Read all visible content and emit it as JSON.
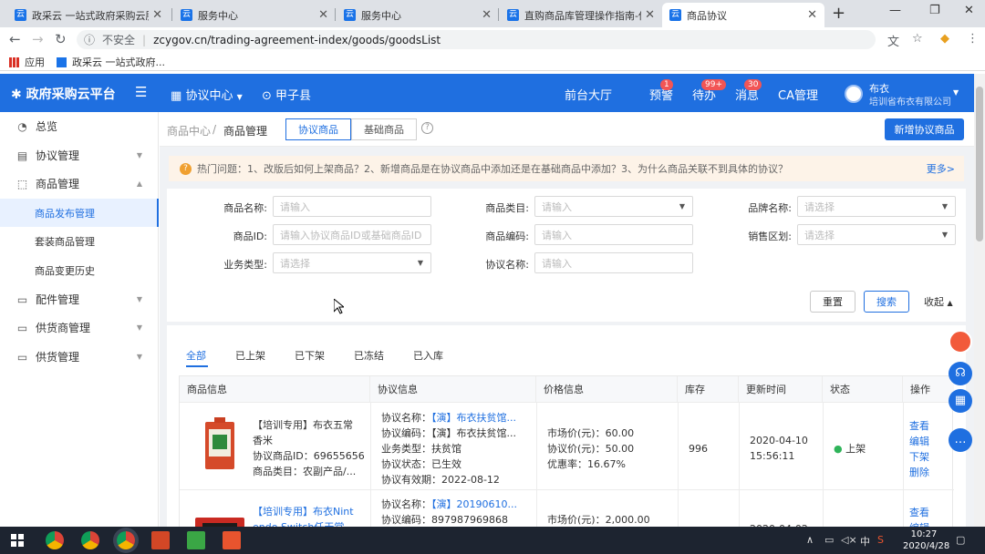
{
  "browser": {
    "tabs": [
      {
        "title": "政采云 一站式政府采购云服务"
      },
      {
        "title": "服务中心"
      },
      {
        "title": "服务中心"
      },
      {
        "title": "直购商品库管理操作指南-供应"
      },
      {
        "title": "商品协议"
      }
    ],
    "insecure_label": "不安全",
    "url": "zcygov.cn/trading-agreement-index/goods/goodsList",
    "bookmarks": [
      {
        "label": "应用"
      },
      {
        "label": "政采云 一站式政府..."
      }
    ]
  },
  "topnav": {
    "brand": "政府采购云平台",
    "agreement_center": "协议中心",
    "region": "甲子县",
    "hall": "前台大厅",
    "warning": "预警",
    "warning_count": "1",
    "todo": "待办",
    "todo_count": "99+",
    "messages": "消息",
    "messages_count": "30",
    "ca": "CA管理",
    "user_name": "布衣",
    "user_org": "培训省布衣有限公司"
  },
  "sidebar": {
    "items": [
      {
        "label": "总览"
      },
      {
        "label": "协议管理"
      },
      {
        "label": "商品管理"
      },
      {
        "label": "商品发布管理"
      },
      {
        "label": "套装商品管理"
      },
      {
        "label": "商品变更历史"
      },
      {
        "label": "配件管理"
      },
      {
        "label": "供货商管理"
      },
      {
        "label": "供货管理"
      }
    ]
  },
  "breadcrumb": {
    "root": "商品中心",
    "sep": "/",
    "current": "商品管理"
  },
  "segments": {
    "agreement_goods": "协议商品",
    "base_goods": "基础商品"
  },
  "new_button": "新增协议商品",
  "notice": {
    "text": "热门问题：1、改版后如何上架商品？2、新增商品是在协议商品中添加还是在基础商品中添加？3、为什么商品关联不到具体的协议？",
    "more": "更多>"
  },
  "filters": {
    "name_label": "商品名称:",
    "name_placeholder": "请输入",
    "category_label": "商品类目:",
    "category_placeholder": "请输入",
    "brand_label": "品牌名称:",
    "brand_placeholder": "请选择",
    "id_label": "商品ID:",
    "id_placeholder": "请输入协议商品ID或基础商品ID",
    "code_label": "商品编码:",
    "code_placeholder": "请输入",
    "region_label": "销售区划:",
    "region_placeholder": "请选择",
    "biz_label": "业务类型:",
    "biz_placeholder": "请选择",
    "agreement_label": "协议名称:",
    "agreement_placeholder": "请输入",
    "reset": "重置",
    "search": "搜索",
    "collapse": "收起"
  },
  "status_tabs": [
    "全部",
    "已上架",
    "已下架",
    "已冻结",
    "已入库"
  ],
  "table": {
    "columns": [
      "商品信息",
      "协议信息",
      "价格信息",
      "库存",
      "更新时间",
      "状态",
      "操作"
    ],
    "rows": [
      {
        "product_name_1": "【培训专用】布衣五常",
        "product_name_2": "香米",
        "product_id": "协议商品ID：69655656",
        "product_cat": "商品类目：农副产品/...",
        "agr_name_label": "协议名称：",
        "agr_name": "【演】布衣扶贫馆...",
        "agr_code": "协议编码：【演】布衣扶贫馆...",
        "biz_type": "业务类型：扶贫馆",
        "agr_status": "协议状态：已生效",
        "agr_valid": "协议有效期：2022-08-12",
        "market_price": "市场价(元)：60.00",
        "agr_price": "协议价(元)：50.00",
        "discount": "优惠率：16.67%",
        "stock": "996",
        "updated_date": "2020-04-10",
        "updated_time": "15:56:11",
        "status": "上架",
        "ops": [
          "查看",
          "编辑",
          "下架",
          "删除"
        ]
      },
      {
        "product_name_1": "【培训专用】布衣Nint",
        "product_name_2": "endo Switch任天堂",
        "agr_name_label": "协议名称：",
        "agr_name": "【演】20190610...",
        "agr_code": "协议编码：897987969868",
        "market_price": "市场价(元)：2,000.00",
        "updated_date": "2020-04-02",
        "ops": [
          "查看",
          "编辑"
        ]
      }
    ]
  },
  "taskbar": {
    "tray_lang": "中",
    "time": "10:27",
    "date": "2020/4/28"
  },
  "colors": {
    "primary": "#1f6fe0",
    "badge": "#f25555",
    "notice_bg": "#fdf3e8",
    "status_on": "#2fb45a"
  }
}
